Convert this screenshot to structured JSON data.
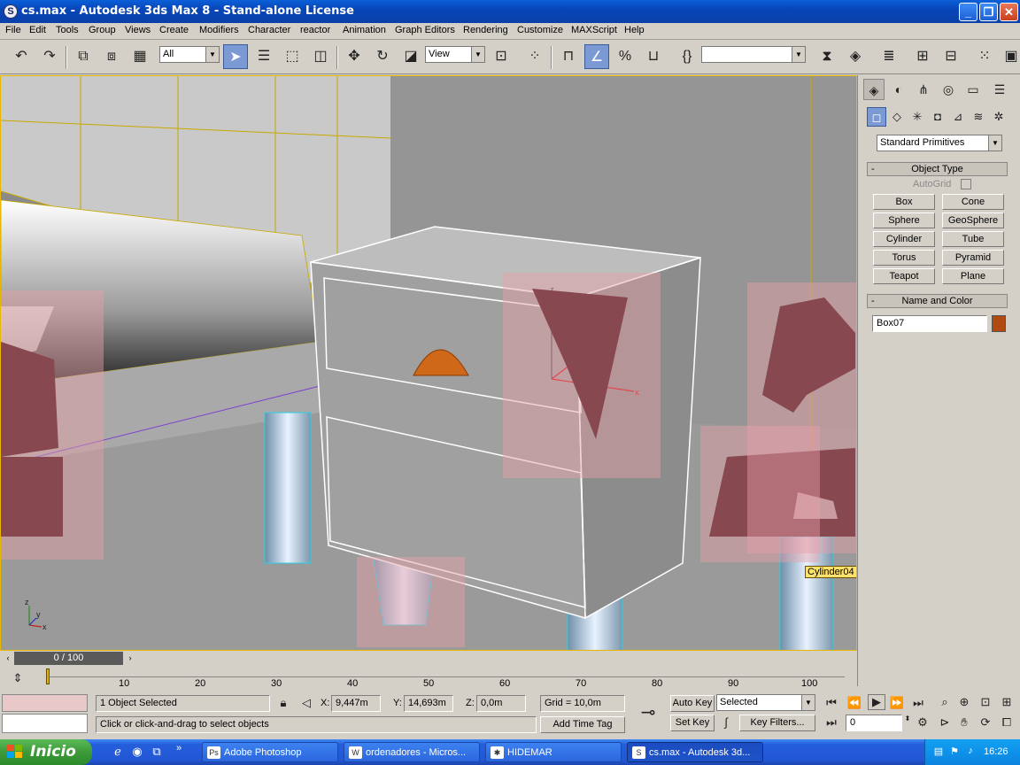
{
  "window": {
    "title": "cs.max - Autodesk 3ds Max 8  - Stand-alone License",
    "app_icon": "3ds-max-icon",
    "minimize": "_",
    "maximize": "❐",
    "close": "✕"
  },
  "menu": [
    "File",
    "Edit",
    "Tools",
    "Group",
    "Views",
    "Create",
    "Modifiers",
    "Character",
    "reactor",
    "Animation",
    "Graph Editors",
    "Rendering",
    "Customize",
    "MAXScript",
    "Help"
  ],
  "toolbar": {
    "selection_filter": "All",
    "reference_coord": "View",
    "named_selection": ""
  },
  "viewport": {
    "tooltip": "Cylinder04",
    "axis_labels": {
      "z": "z",
      "y": "y",
      "x": "x"
    },
    "gizmo_labels": {
      "z": "z",
      "x": "x"
    }
  },
  "command_panel": {
    "category": "Standard Primitives",
    "object_type_title": "Object Type",
    "autogrid_label": "AutoGrid",
    "buttons": [
      "Box",
      "Cone",
      "Sphere",
      "GeoSphere",
      "Cylinder",
      "Tube",
      "Torus",
      "Pyramid",
      "Teapot",
      "Plane"
    ],
    "name_color_title": "Name and Color",
    "object_name": "Box07",
    "object_color": "#b04a10",
    "rollout_toggle": "-"
  },
  "timeline": {
    "frame_display": "0 / 100",
    "ticks": [
      "10",
      "20",
      "30",
      "40",
      "50",
      "60",
      "70",
      "80",
      "90",
      "100"
    ]
  },
  "status": {
    "selection_count": "1 Object Selected",
    "prompt": "Click or click-and-drag to select objects",
    "x_label": "X:",
    "x_value": "9,447m",
    "y_label": "Y:",
    "y_value": "14,693m",
    "z_label": "Z:",
    "z_value": "0,0m",
    "grid": "Grid = 10,0m",
    "add_time_tag": "Add Time Tag",
    "auto_key": "Auto Key",
    "set_key": "Set Key",
    "key_mode": "Selected",
    "key_filters": "Key Filters...",
    "current_frame": "0"
  },
  "taskbar": {
    "start": "Inicio",
    "tasks": [
      "Adobe Photoshop",
      "ordenadores - Micros...",
      "HIDEMAR",
      "cs.max - Autodesk 3d..."
    ],
    "clock": "16:26"
  }
}
